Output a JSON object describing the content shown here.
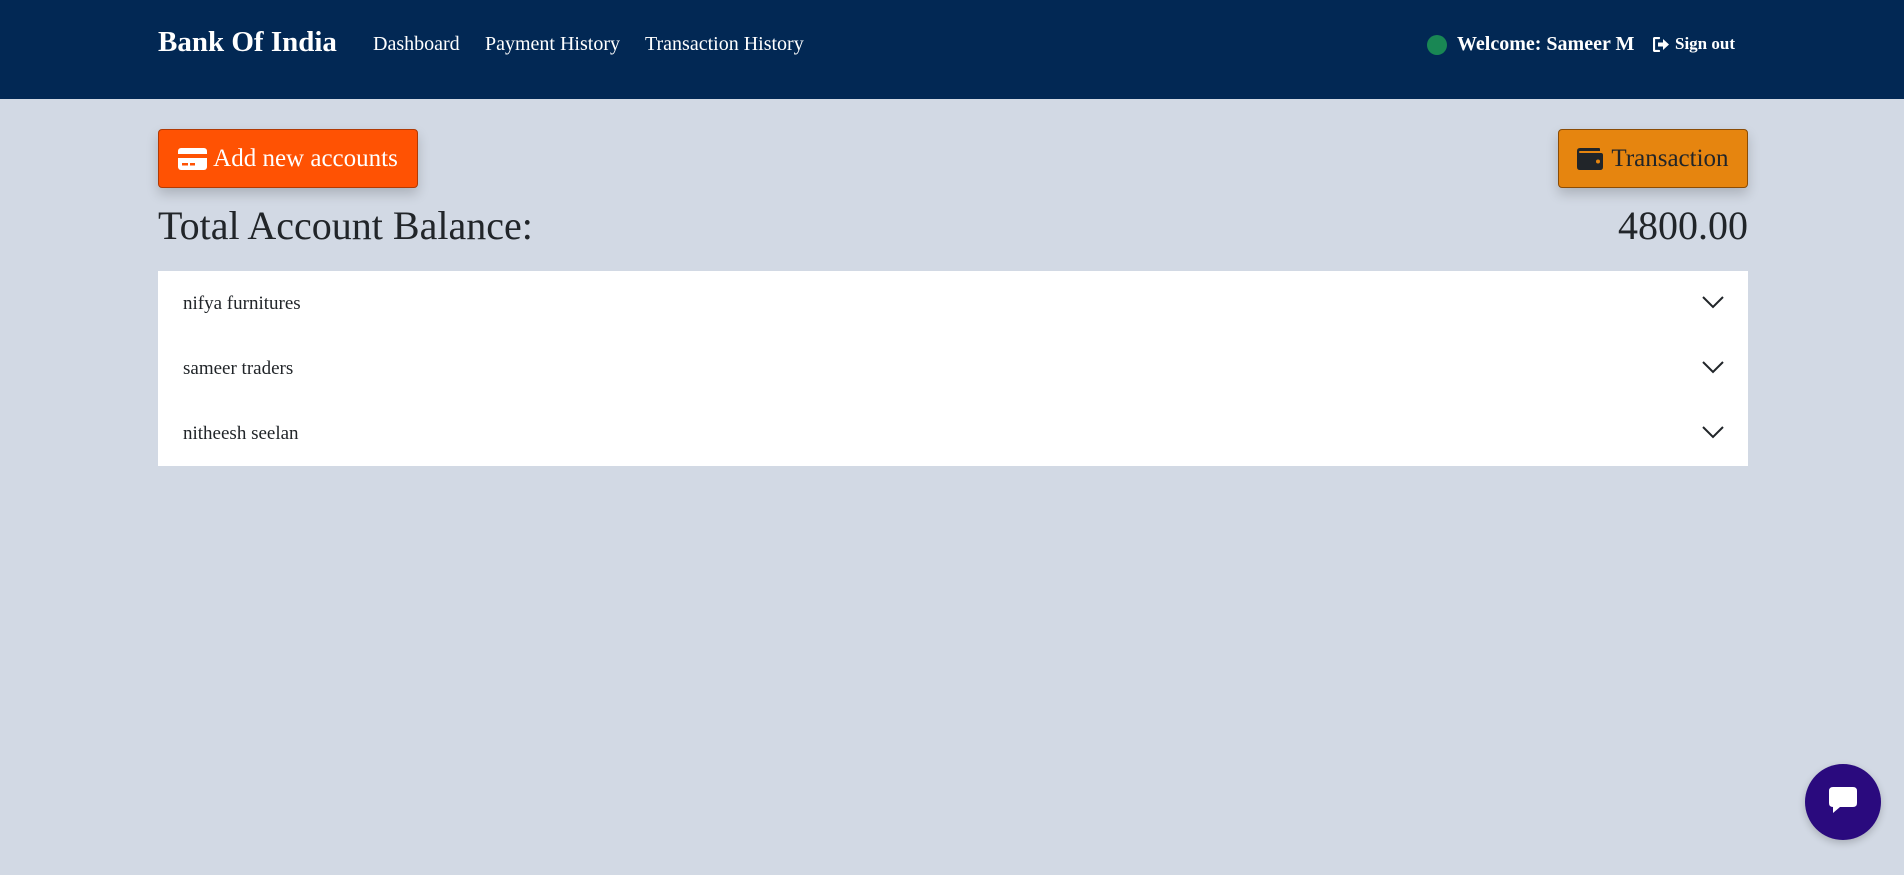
{
  "navbar": {
    "brand": "Bank Of India",
    "links": [
      "Dashboard",
      "Payment History",
      "Transaction History"
    ],
    "welcome": "Welcome: Sameer M",
    "signout": "Sign out",
    "status_color": "#198754",
    "background_color": "#022854"
  },
  "actions": {
    "add_accounts": "Add new accounts",
    "transaction": "Transaction",
    "add_accounts_color": "#ff5203",
    "transaction_color": "#e6850f"
  },
  "balance": {
    "label": "Total Account Balance:",
    "value": "4800.00"
  },
  "accounts": [
    {
      "name": "nifya furnitures"
    },
    {
      "name": "sameer traders"
    },
    {
      "name": "nitheesh seelan"
    }
  ],
  "chat": {
    "icon": "chat-bubble-icon",
    "color": "#2a0a7e"
  }
}
